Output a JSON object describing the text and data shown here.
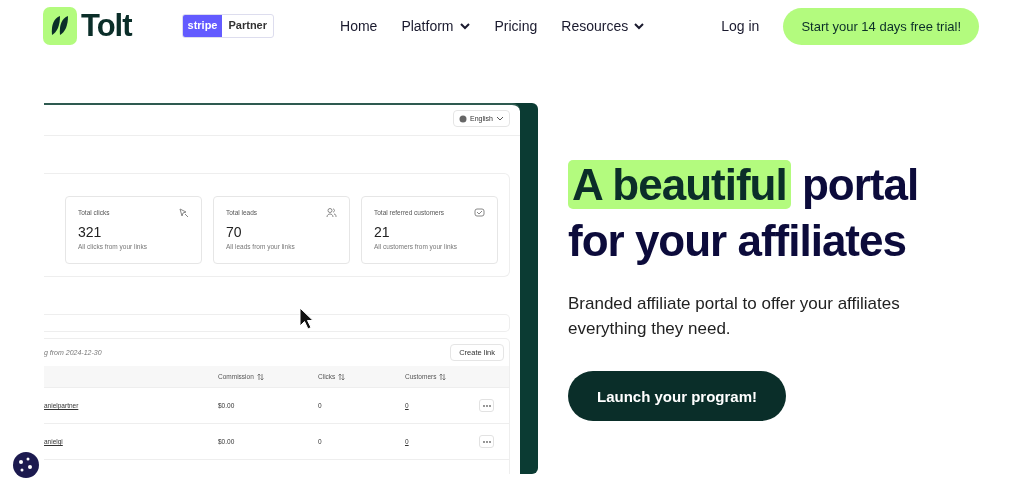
{
  "header": {
    "logo": "Tolt",
    "partner_badge": {
      "brand": "stripe",
      "label": "Partner"
    },
    "nav": [
      {
        "label": "Home",
        "dropdown": false
      },
      {
        "label": "Platform",
        "dropdown": true
      },
      {
        "label": "Pricing",
        "dropdown": false
      },
      {
        "label": "Resources",
        "dropdown": true
      }
    ],
    "login": "Log in",
    "cta": "Start your 14 days free trial!"
  },
  "preview": {
    "language": "English",
    "stats": [
      {
        "title": "Total clicks",
        "value": "321",
        "caption": "All clicks from your links",
        "kind": "clicks"
      },
      {
        "title": "Total leads",
        "value": "70",
        "caption": "All leads from your links",
        "kind": "leads"
      },
      {
        "title": "Total referred customers",
        "value": "21",
        "caption": "All customers from your links",
        "kind": "customers"
      }
    ],
    "table": {
      "caption": "g from 2024-12-30",
      "create_button": "Create link",
      "columns": [
        "Commission",
        "Clicks",
        "Customers"
      ],
      "rows": [
        {
          "link": "anielpartner",
          "commission": "$0.00",
          "clicks": "0",
          "customers": "0"
        },
        {
          "link": "anielgi",
          "commission": "$0.00",
          "clicks": "0",
          "customers": "0"
        }
      ]
    }
  },
  "hero": {
    "highlight": "A beautiful",
    "line1_rest": "portal",
    "line2": "for your affiliates",
    "subtitle": "Branded affiliate portal to offer your affiliates everything they need.",
    "button": "Launch your program!"
  }
}
